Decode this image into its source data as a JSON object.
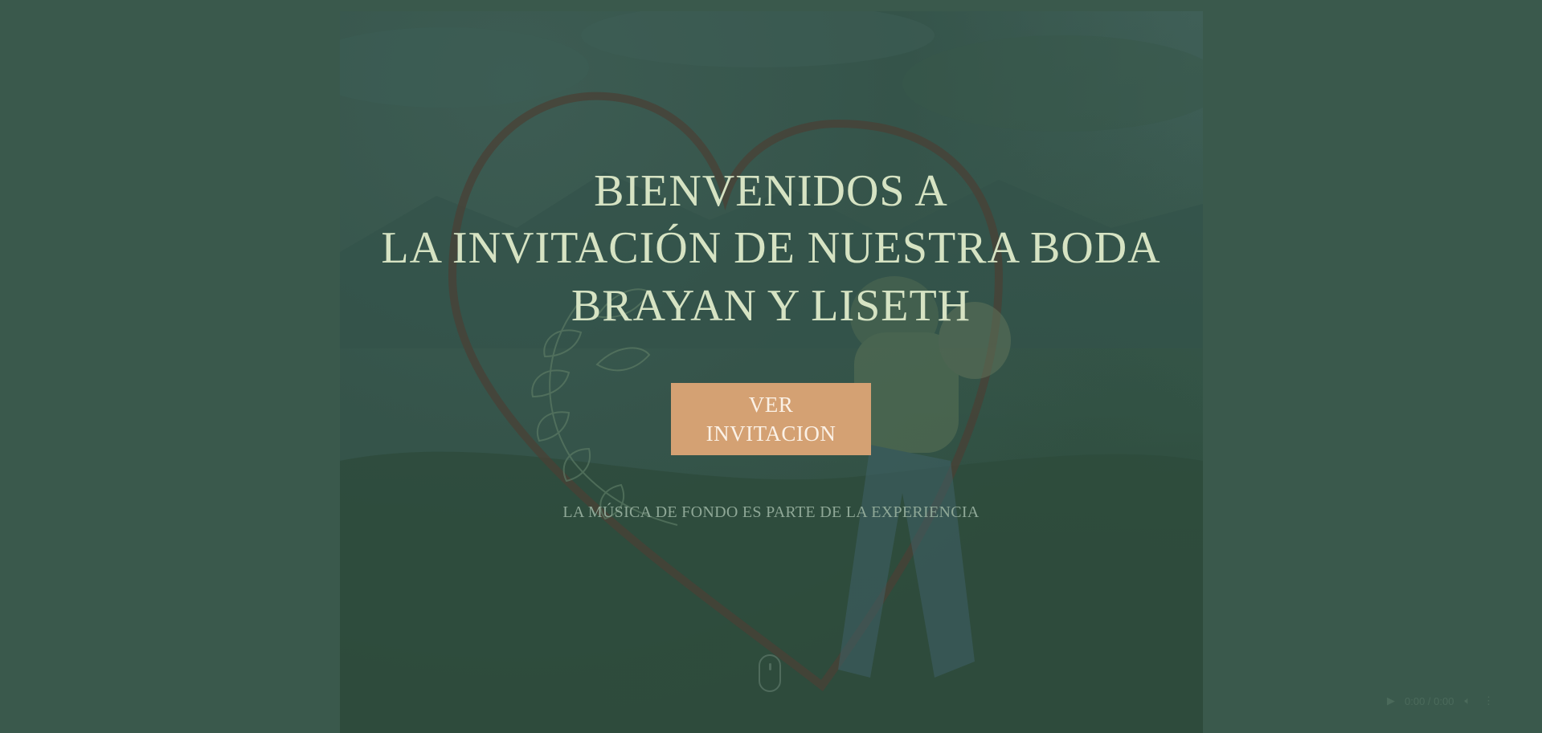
{
  "hero": {
    "line1": "BIENVENIDOS A",
    "line2": "LA INVITACIÓN DE NUESTRA BODA",
    "line3": "BRAYAN Y LISETH"
  },
  "cta": {
    "label": "VER\nINVITACION"
  },
  "music_note": "LA MÚSICA DE FONDO ES PARTE DE LA EXPERIENCIA",
  "player": {
    "play_icon": "play-icon",
    "time": "0:00 / 0:00",
    "volume_icon": "volume-icon",
    "menu_icon": "more-vertical-icon"
  },
  "colors": {
    "page_bg": "#3a594c",
    "heading": "#d6e3c3",
    "button_bg": "#d4a173",
    "button_text": "#fbf1e6",
    "muted_text": "#8fa897"
  }
}
